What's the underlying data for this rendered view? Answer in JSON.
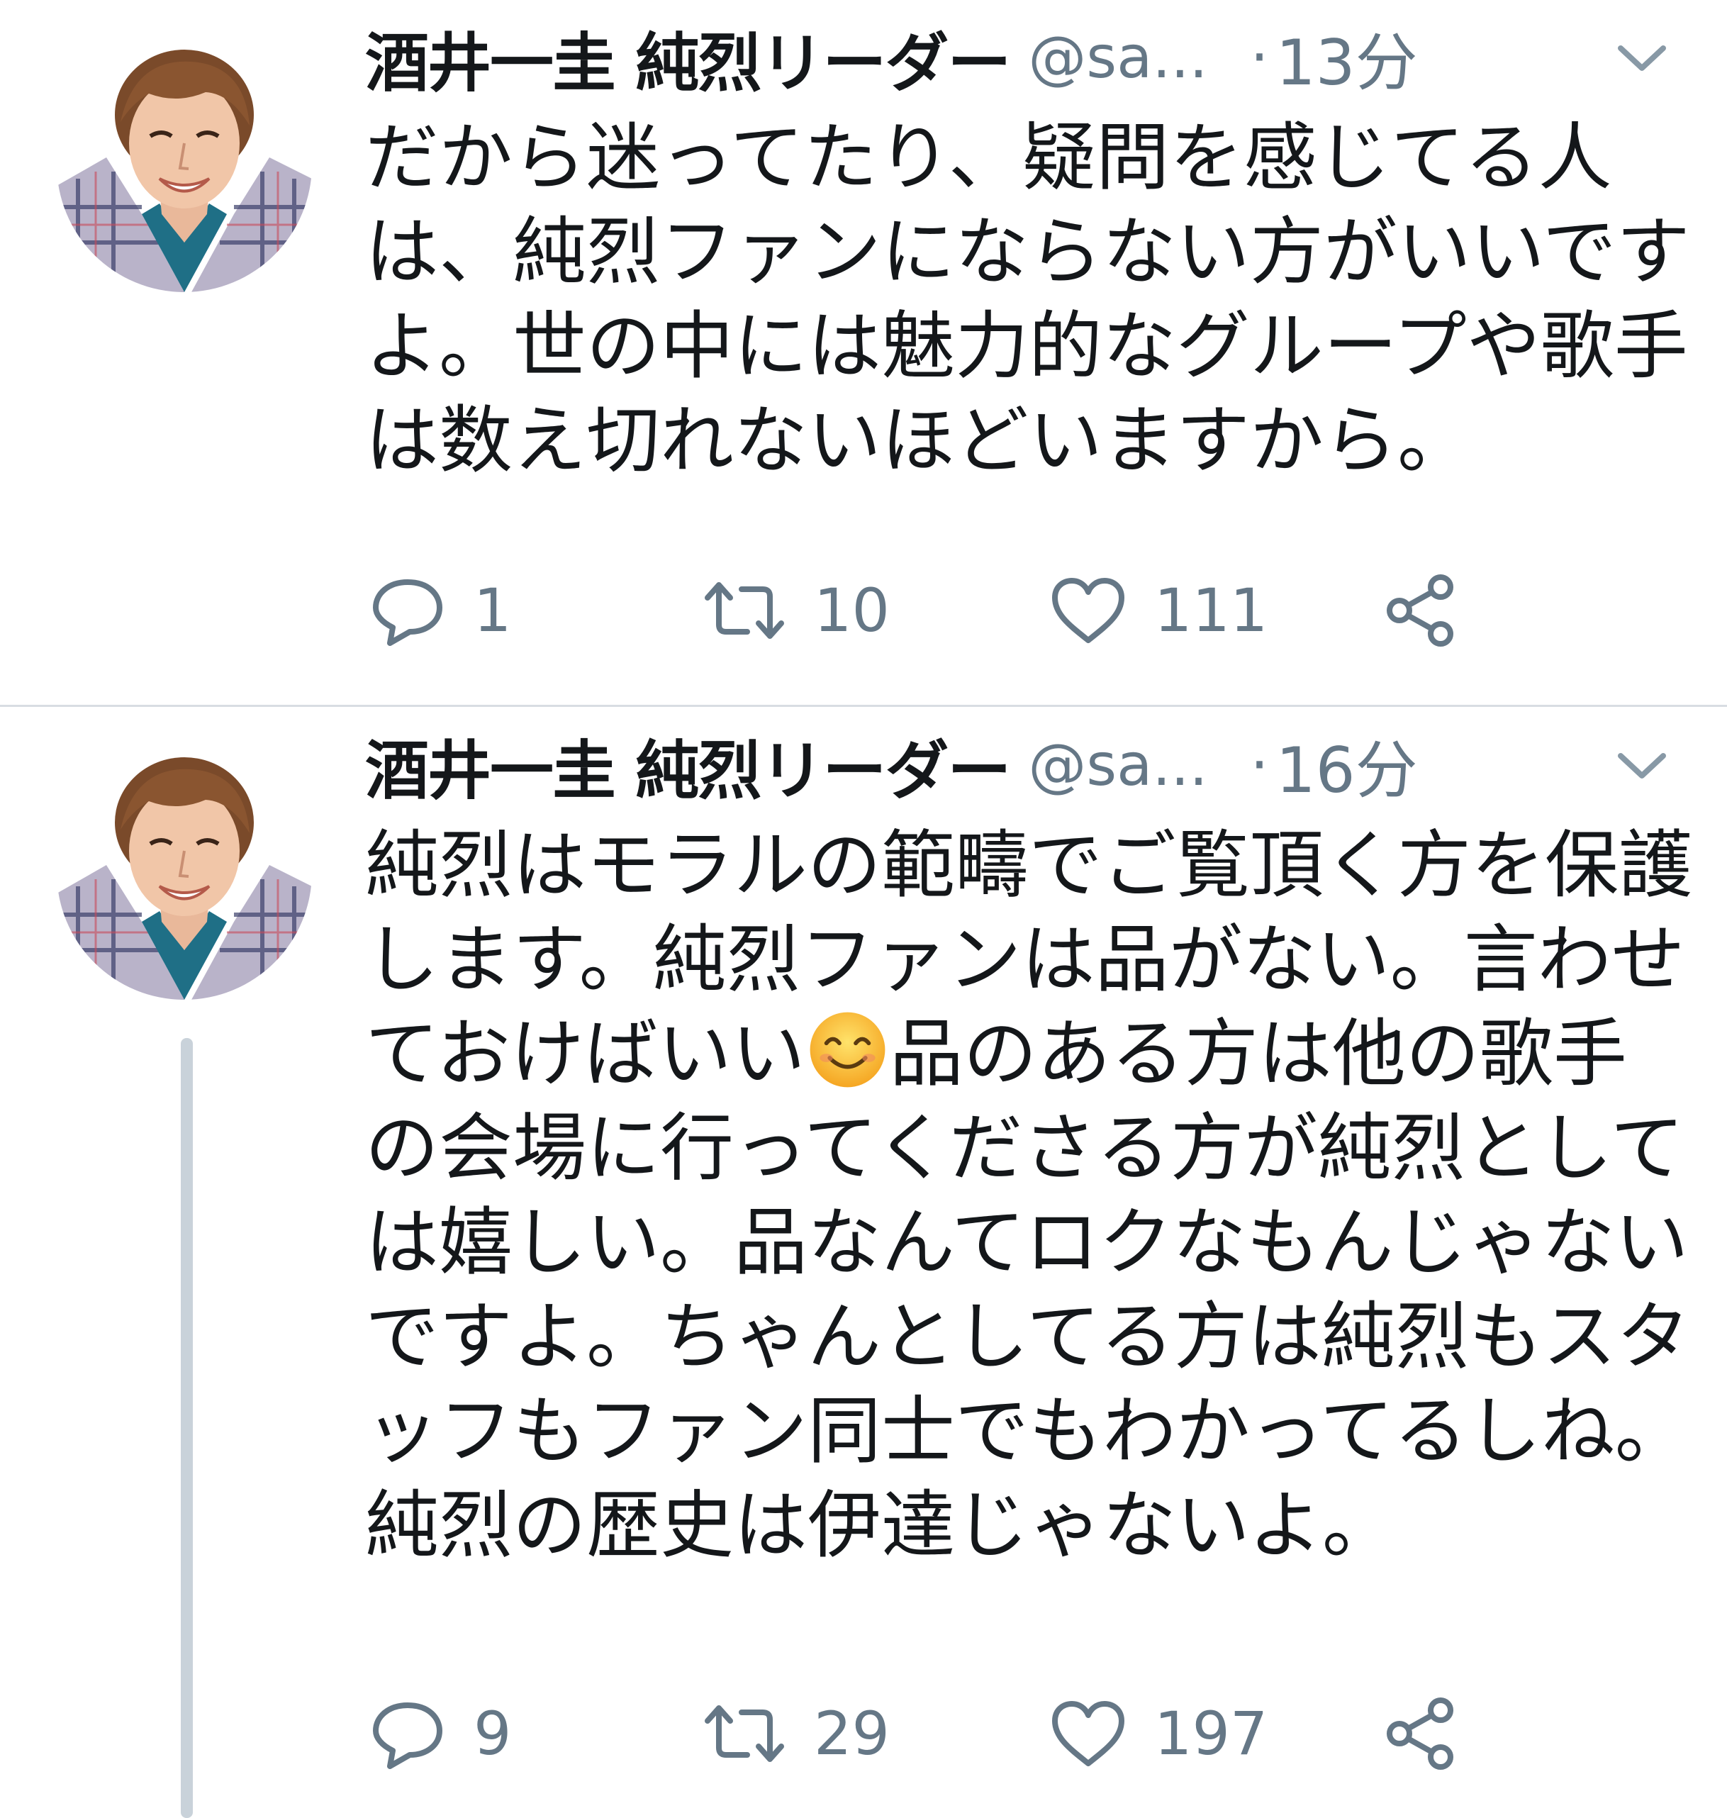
{
  "tweets": [
    {
      "author_name": "酒井一圭  純烈リーダー",
      "handle": "@sa...",
      "separator": "·",
      "time": "13分",
      "text_lines": [
        "だから迷ってたり、疑問を感じてる人",
        "は、純烈ファンにならない方がいいです",
        "よ。世の中には魅力的なグループや歌手",
        "は数え切れないほどいますから。"
      ],
      "reply_count": "1",
      "retweet_count": "10",
      "like_count": "111"
    },
    {
      "author_name": "酒井一圭  純烈リーダー",
      "handle": "@sa...",
      "separator": "·",
      "time": "16分",
      "text_lines": [
        "純烈はモラルの範疇でご覧頂く方を保護",
        "します。純烈ファンは品がない。言わせ",
        "ておけばいい",
        "品のある方は他の歌手",
        "の会場に行ってくださる方が純烈として",
        "は嬉しい。品なんてロクなもんじゃない",
        "ですよ。ちゃんとしてる方は純烈もスタ",
        "ッフもファン同士でもわかってるしね。",
        "純烈の歴史は伊達じゃないよ。"
      ],
      "emoji": "smiling-face-emoji",
      "reply_count": "9",
      "retweet_count": "29",
      "like_count": "197"
    }
  ],
  "colors": {
    "text": "#14171a",
    "secondary": "#657786",
    "divider": "#d8dde2",
    "thread_line": "#c9d2da"
  },
  "icons": {
    "reply": "reply-icon",
    "retweet": "retweet-icon",
    "like": "heart-icon",
    "share": "share-icon",
    "menu": "chevron-down-icon"
  }
}
